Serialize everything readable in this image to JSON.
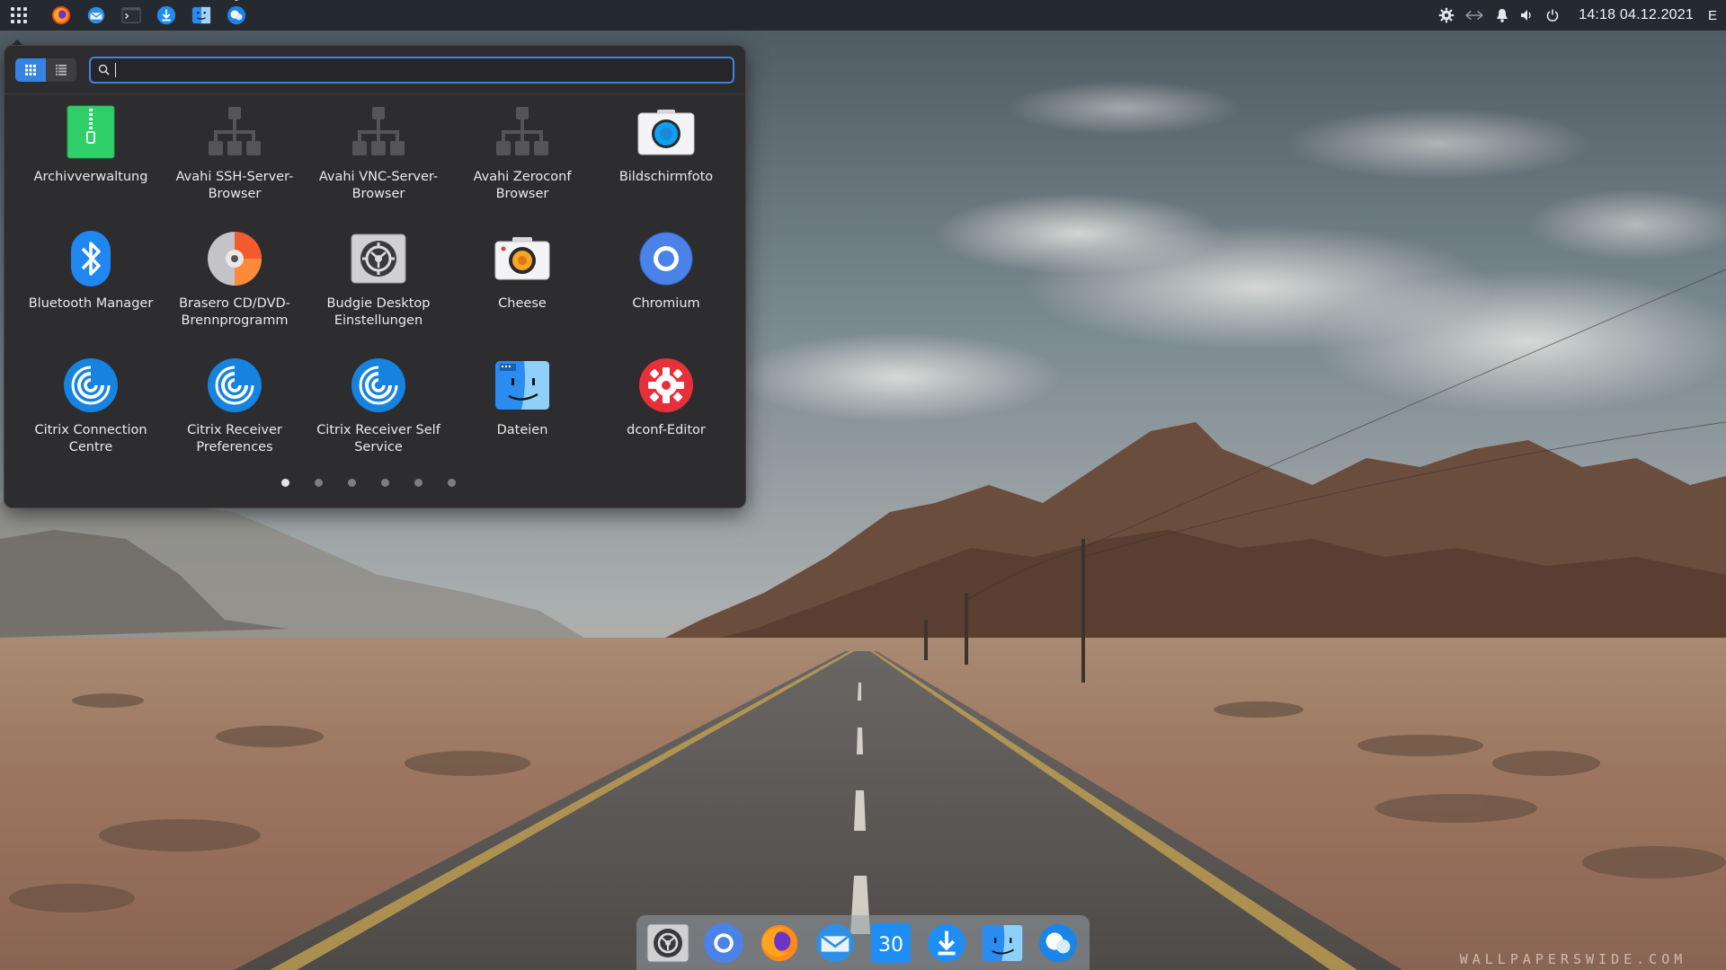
{
  "top_panel": {
    "launchers": [
      {
        "name": "firefox"
      },
      {
        "name": "mail"
      },
      {
        "name": "terminal"
      },
      {
        "name": "software-center"
      },
      {
        "name": "files"
      },
      {
        "name": "messaging"
      }
    ],
    "tray": {
      "clock": "14:18 04.12.2021",
      "keyboard_layout": "E"
    }
  },
  "app_menu": {
    "search": {
      "placeholder": "",
      "value": ""
    },
    "apps": [
      {
        "label": "Archivverwaltung",
        "icon": "archive-manager-icon"
      },
      {
        "label": "Avahi SSH-Server-Browser",
        "icon": "network-icon"
      },
      {
        "label": "Avahi VNC-Server-Browser",
        "icon": "network-icon"
      },
      {
        "label": "Avahi Zeroconf Browser",
        "icon": "network-icon"
      },
      {
        "label": "Bildschirmfoto",
        "icon": "screenshot-icon"
      },
      {
        "label": "Bluetooth Manager",
        "icon": "bluetooth-icon"
      },
      {
        "label": "Brasero CD/DVD-Brennprogramm",
        "icon": "disc-burner-icon"
      },
      {
        "label": "Budgie Desktop Einstellungen",
        "icon": "settings-gear-icon"
      },
      {
        "label": "Cheese",
        "icon": "camera-icon"
      },
      {
        "label": "Chromium",
        "icon": "chromium-icon"
      },
      {
        "label": "Citrix Connection Centre",
        "icon": "citrix-icon"
      },
      {
        "label": "Citrix Receiver Preferences",
        "icon": "citrix-icon"
      },
      {
        "label": "Citrix Receiver Self Service",
        "icon": "citrix-icon"
      },
      {
        "label": "Dateien",
        "icon": "finder-icon"
      },
      {
        "label": "dconf-Editor",
        "icon": "dconf-gear-icon"
      }
    ],
    "pages": {
      "count": 6,
      "current": 1
    }
  },
  "dock": {
    "items": [
      {
        "name": "settings"
      },
      {
        "name": "chromium"
      },
      {
        "name": "firefox"
      },
      {
        "name": "mail"
      },
      {
        "name": "calendar",
        "text": "30"
      },
      {
        "name": "software-center"
      },
      {
        "name": "files"
      },
      {
        "name": "messaging"
      }
    ]
  },
  "wallpaper": {
    "watermark": "WALLPAPERSWIDE.COM"
  },
  "colors": {
    "accent": "#3584e4",
    "menu_bg": "#2d2d2f",
    "panel_bg": "#1c2026"
  }
}
